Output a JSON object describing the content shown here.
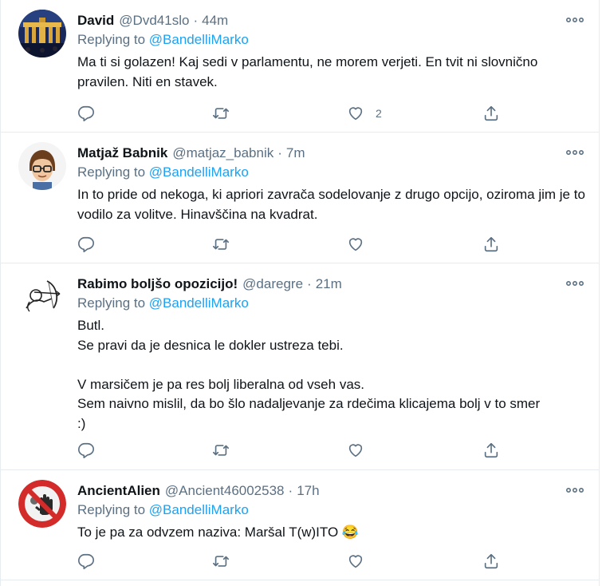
{
  "tweets": [
    {
      "name": "David",
      "handle": "@Dvd41slo",
      "time": "44m",
      "replying_prefix": "Replying to",
      "replying_to": "@BandelliMarko",
      "text": "Ma ti si golazen! Kaj sedi v parlamentu, ne morem verjeti. En tvit ni slovnično pravilen. Niti en stavek.",
      "like_count": "2",
      "avatar": "brandenburg-gate-night-photo"
    },
    {
      "name": "Matjaž Babnik",
      "handle": "@matjaz_babnik",
      "time": "7m",
      "replying_prefix": "Replying to",
      "replying_to": "@BandelliMarko",
      "text": "In to pride od nekoga, ki apriori zavrača sodelovanje z drugo opcijo, oziroma jim je to vodilo za volitve. Hinavščina na kvadrat.",
      "like_count": "",
      "avatar": "cartoon-man-with-glasses"
    },
    {
      "name": "Rabimo boljšo opozicijo!",
      "handle": "@daregre",
      "time": "21m",
      "replying_prefix": "Replying to",
      "replying_to": "@BandelliMarko",
      "text": "Butl.\nSe pravi da je desnica le dokler ustreza tebi.\n\nV marsičem je pa res bolj liberalna od vseh vas.\nSem naivno mislil, da bo šlo nadaljevanje za rdečima klicajema bolj v to smer\n:)",
      "like_count": "",
      "avatar": "cupid-archer-sketch"
    },
    {
      "name": "AncientAlien",
      "handle": "@Ancient46002538",
      "time": "17h",
      "replying_prefix": "Replying to",
      "replying_to": "@BandelliMarko",
      "text": "To je pa za odvzem naziva: Maršal T(w)ITO 😂",
      "like_count": "",
      "avatar": "no-entry-hand-sign"
    }
  ],
  "colors": {
    "accent": "#1da1f2",
    "secondary_text": "#5b7083",
    "divider": "#e6ecf0"
  }
}
